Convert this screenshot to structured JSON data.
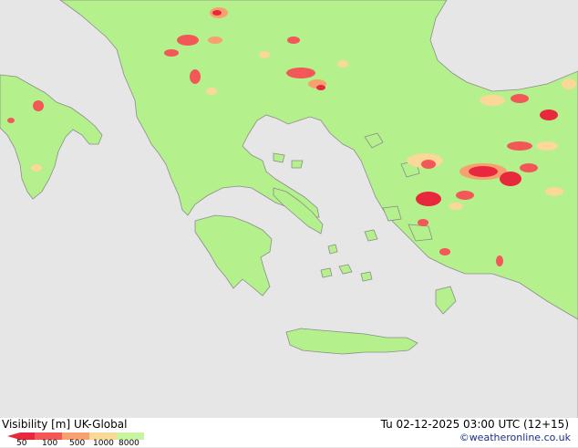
{
  "title": {
    "variable": "Visibility [m]",
    "model": "UK-Global"
  },
  "valid_time": "Tu 02-12-2025 03:00 UTC (12+15)",
  "credit": "©weatheronline.co.uk",
  "legend": {
    "ticks": [
      "50",
      "100",
      "500",
      "1000",
      "8000"
    ],
    "colors": [
      "#e8283c",
      "#f25858",
      "#f7a070",
      "#f9d898",
      "#c8f6a0"
    ]
  },
  "map": {
    "sea_color": "#e6e6e6",
    "land_color": "#b4f08c",
    "coast_color": "#8c8c8c",
    "region": "Greece, Aegean Sea, Western Turkey, Southern Italy, Balkans"
  }
}
